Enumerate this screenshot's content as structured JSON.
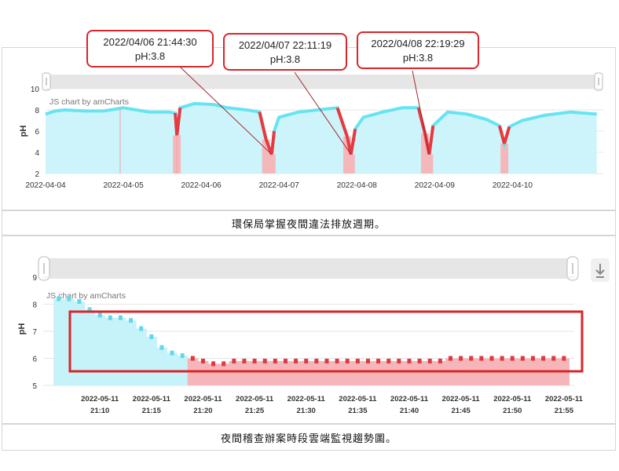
{
  "chart_data": [
    {
      "type": "area",
      "ylabel": "pH",
      "ylim": [
        2,
        10
      ],
      "yticks": [
        2,
        4,
        6,
        8,
        10
      ],
      "xlim": [
        "2022-04-04",
        "2022-04-10"
      ],
      "xticks": [
        "2022-04-04",
        "2022-04-05",
        "2022-04-06",
        "2022-04-07",
        "2022-04-08",
        "2022-04-09",
        "2022-04-10"
      ],
      "watermark": "JS chart by amCharts",
      "series": [
        {
          "color": "#66e4f2",
          "alert_color": "#e8393f",
          "points": [
            [
              "2022-04-04 00:00",
              7.6
            ],
            [
              "2022-04-04 03:00",
              7.9
            ],
            [
              "2022-04-04 06:00",
              8.0
            ],
            [
              "2022-04-04 12:00",
              7.9
            ],
            [
              "2022-04-04 18:00",
              7.9
            ],
            [
              "2022-04-04 22:00",
              8.1
            ],
            [
              "2022-04-05 00:00",
              8.2
            ],
            [
              "2022-04-05 04:00",
              8.0
            ],
            [
              "2022-04-05 08:00",
              7.8
            ],
            [
              "2022-04-05 14:00",
              7.8
            ],
            [
              "2022-04-05 16:00",
              7.7
            ],
            [
              "2022-04-05 16:30",
              5.6
            ],
            [
              "2022-04-05 17:30",
              8.2
            ],
            [
              "2022-04-05 22:00",
              8.6
            ],
            [
              "2022-04-06 04:00",
              8.5
            ],
            [
              "2022-04-06 08:00",
              8.2
            ],
            [
              "2022-04-06 14:00",
              8.0
            ],
            [
              "2022-04-06 18:00",
              7.8
            ],
            [
              "2022-04-06 20:00",
              5.2
            ],
            [
              "2022-04-06 21:44",
              3.8
            ],
            [
              "2022-04-06 22:30",
              6.0
            ],
            [
              "2022-04-07 00:00",
              7.3
            ],
            [
              "2022-04-07 06:00",
              7.8
            ],
            [
              "2022-04-07 12:00",
              8.0
            ],
            [
              "2022-04-07 18:00",
              8.2
            ],
            [
              "2022-04-07 21:00",
              5.5
            ],
            [
              "2022-04-07 22:11",
              3.8
            ],
            [
              "2022-04-07 23:30",
              6.2
            ],
            [
              "2022-04-08 02:00",
              7.3
            ],
            [
              "2022-04-08 08:00",
              7.8
            ],
            [
              "2022-04-08 14:00",
              8.2
            ],
            [
              "2022-04-08 19:00",
              8.2
            ],
            [
              "2022-04-08 21:00",
              5.8
            ],
            [
              "2022-04-08 22:19",
              3.8
            ],
            [
              "2022-04-08 23:30",
              6.5
            ],
            [
              "2022-04-09 04:00",
              7.8
            ],
            [
              "2022-04-09 10:00",
              7.6
            ],
            [
              "2022-04-09 16:00",
              7.1
            ],
            [
              "2022-04-09 20:00",
              6.5
            ],
            [
              "2022-04-09 21:30",
              4.8
            ],
            [
              "2022-04-09 23:00",
              6.4
            ],
            [
              "2022-04-10 03:00",
              7.0
            ],
            [
              "2022-04-10 10:00",
              7.5
            ],
            [
              "2022-04-10 18:00",
              7.8
            ],
            [
              "2022-04-11 02:00",
              7.6
            ]
          ]
        }
      ]
    },
    {
      "type": "area",
      "ylabel": "pH",
      "ylim": [
        5,
        9
      ],
      "yticks": [
        5,
        6,
        7,
        8,
        9
      ],
      "xlim": [
        "2022-05-11 21:06",
        "2022-05-11 21:55"
      ],
      "xticks": [
        [
          "2022-05-11",
          "21:10"
        ],
        [
          "2022-05-11",
          "21:15"
        ],
        [
          "2022-05-11",
          "21:20"
        ],
        [
          "2022-05-11",
          "21:25"
        ],
        [
          "2022-05-11",
          "21:30"
        ],
        [
          "2022-05-11",
          "21:35"
        ],
        [
          "2022-05-11",
          "21:40"
        ],
        [
          "2022-05-11",
          "21:45"
        ],
        [
          "2022-05-11",
          "21:50"
        ],
        [
          "2022-05-11",
          "21:55"
        ]
      ],
      "watermark": "JS chart by amCharts",
      "normal_color": "#5fd9ea",
      "alert_color": "#e0383f",
      "alert_from": "21:19",
      "series": [
        {
          "points": [
            [
              "21:06",
              8.2
            ],
            [
              "21:07",
              8.2
            ],
            [
              "21:08",
              8.1
            ],
            [
              "21:09",
              7.8
            ],
            [
              "21:10",
              7.6
            ],
            [
              "21:11",
              7.5
            ],
            [
              "21:12",
              7.5
            ],
            [
              "21:13",
              7.4
            ],
            [
              "21:14",
              7.1
            ],
            [
              "21:15",
              6.8
            ],
            [
              "21:16",
              6.4
            ],
            [
              "21:17",
              6.2
            ],
            [
              "21:18",
              6.1
            ],
            [
              "21:19",
              6.0
            ],
            [
              "21:20",
              5.9
            ],
            [
              "21:21",
              5.8
            ],
            [
              "21:22",
              5.8
            ],
            [
              "21:23",
              5.9
            ],
            [
              "21:24",
              5.9
            ],
            [
              "21:25",
              5.9
            ],
            [
              "21:26",
              5.9
            ],
            [
              "21:27",
              5.9
            ],
            [
              "21:28",
              5.9
            ],
            [
              "21:29",
              5.9
            ],
            [
              "21:30",
              5.9
            ],
            [
              "21:31",
              5.9
            ],
            [
              "21:32",
              5.9
            ],
            [
              "21:33",
              5.9
            ],
            [
              "21:34",
              5.9
            ],
            [
              "21:35",
              5.9
            ],
            [
              "21:36",
              5.9
            ],
            [
              "21:37",
              5.9
            ],
            [
              "21:38",
              5.9
            ],
            [
              "21:39",
              5.9
            ],
            [
              "21:40",
              5.9
            ],
            [
              "21:41",
              5.9
            ],
            [
              "21:42",
              5.9
            ],
            [
              "21:43",
              5.9
            ],
            [
              "21:44",
              6.0
            ],
            [
              "21:45",
              6.0
            ],
            [
              "21:46",
              6.0
            ],
            [
              "21:47",
              6.0
            ],
            [
              "21:48",
              6.0
            ],
            [
              "21:49",
              6.0
            ],
            [
              "21:50",
              6.0
            ],
            [
              "21:51",
              6.0
            ],
            [
              "21:52",
              6.0
            ],
            [
              "21:53",
              6.0
            ],
            [
              "21:54",
              6.0
            ],
            [
              "21:55",
              6.0
            ]
          ]
        }
      ]
    }
  ],
  "annotations": [
    {
      "time": "2022/04/06 21:44:30",
      "value": "pH:3.8"
    },
    {
      "time": "2022/04/07 22:11:19",
      "value": "pH:3.8"
    },
    {
      "time": "2022/04/08 22:19:29",
      "value": "pH:3.8"
    }
  ],
  "captions": {
    "top": "環保局掌握夜間違法排放週期。",
    "bottom": "夜間稽查辦案時段雲端監視趨勢圖。"
  },
  "colors": {
    "highlight_box": "#d8262a",
    "scrollbar": "#e6e6e6"
  },
  "icons": {
    "scroll_grip": "grip-lines-icon",
    "download": "download-arrow-icon"
  }
}
